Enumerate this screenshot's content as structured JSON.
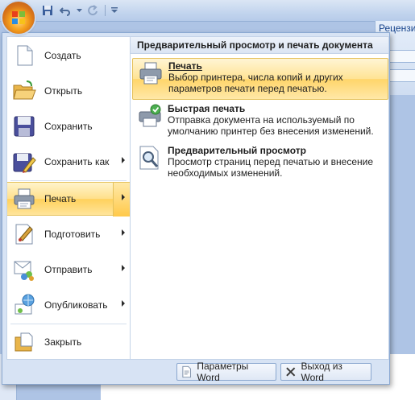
{
  "ribbon": {
    "tab_partial": "Рецензи"
  },
  "menu": {
    "items": [
      {
        "label": "Создать",
        "icon": "new-document-icon",
        "has_submenu": false
      },
      {
        "label": "Открыть",
        "icon": "open-folder-icon",
        "has_submenu": false
      },
      {
        "label": "Сохранить",
        "icon": "save-disk-icon",
        "has_submenu": false
      },
      {
        "label": "Сохранить как",
        "icon": "save-as-icon",
        "has_submenu": true
      },
      {
        "label": "Печать",
        "icon": "printer-icon",
        "has_submenu": true,
        "active": true
      },
      {
        "label": "Подготовить",
        "icon": "prepare-icon",
        "has_submenu": true
      },
      {
        "label": "Отправить",
        "icon": "send-icon",
        "has_submenu": true
      },
      {
        "label": "Опубликовать",
        "icon": "publish-icon",
        "has_submenu": true
      },
      {
        "label": "Закрыть",
        "icon": "close-document-icon",
        "has_submenu": false
      }
    ],
    "submenu": {
      "header": "Предварительный просмотр и печать документа",
      "items": [
        {
          "title": "Печать",
          "desc1": "Выбор принтера, числа копий и других",
          "desc2": "параметров печати перед печатью.",
          "icon": "printer-icon",
          "active": true
        },
        {
          "title": "Быстрая печать",
          "desc1": "Отправка документа на используемый по",
          "desc2": "умолчанию принтер без внесения изменений.",
          "icon": "quick-print-icon"
        },
        {
          "title": "Предварительный просмотр",
          "desc1": "Просмотр страниц перед печатью и внесение",
          "desc2": "необходимых изменений.",
          "icon": "print-preview-icon"
        }
      ]
    },
    "bottom": {
      "options_label": "Параметры Word",
      "exit_label": "Выход из Word"
    }
  },
  "colors": {
    "highlight": "#ffd15c",
    "menu_background": "#d7e3f4",
    "window_chrome": "#c3d5ee"
  }
}
